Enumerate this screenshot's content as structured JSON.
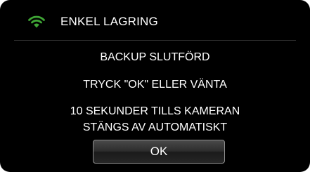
{
  "header": {
    "title": "ENKEL LAGRING",
    "icon": "wifi-icon",
    "icon_color": "#3fa535"
  },
  "message": {
    "line1": "BACKUP SLUTFÖRD",
    "line2": "TRYCK \"OK\" ELLER VÄNTA",
    "line3": "10 SEKUNDER TILLS KAMERAN",
    "line4": "STÄNGS AV AUTOMATISKT"
  },
  "buttons": {
    "ok_label": "OK"
  }
}
